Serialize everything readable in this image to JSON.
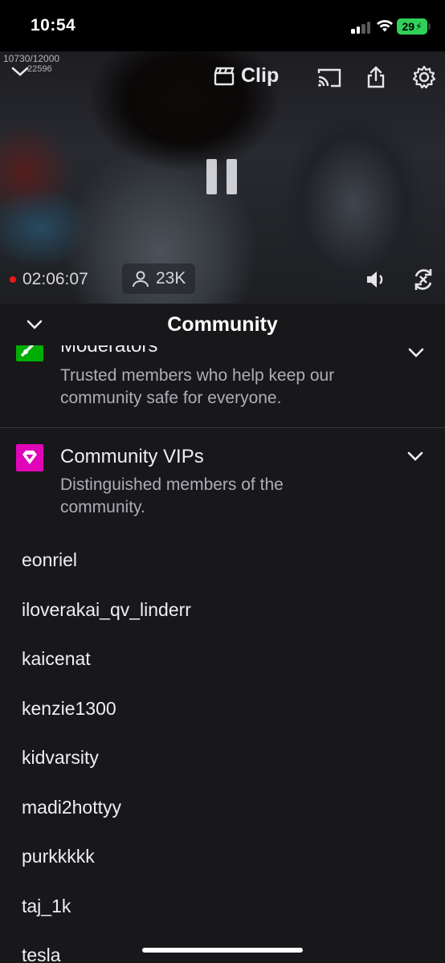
{
  "status_bar": {
    "time": "10:54",
    "battery": "29"
  },
  "player": {
    "overlay_line1": "10730/12000",
    "overlay_line2": "22596",
    "clip_label": "Clip",
    "elapsed": "02:06:07",
    "viewers": "23K"
  },
  "sheet": {
    "title": "Community",
    "moderators": {
      "title": "Moderators",
      "description": "Trusted members who help keep our community safe for everyone."
    },
    "vips": {
      "title": "Community VIPs",
      "description": "Distinguished members of the community."
    },
    "users": [
      "eonriel",
      "iloverakai_qv_linderr",
      "kaicenat",
      "kenzie1300",
      "kidvarsity",
      "madi2hottyy",
      "purkkkkk",
      "taj_1k",
      "tesla"
    ]
  },
  "colors": {
    "moderator_badge": "#00ad03",
    "vip_badge": "#e005b9",
    "live_dot": "#e91916"
  }
}
